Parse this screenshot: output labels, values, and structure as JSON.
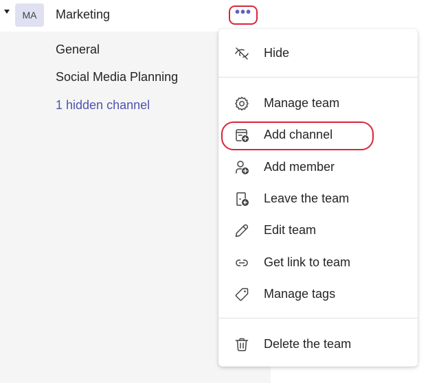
{
  "team": {
    "avatar_initials": "MA",
    "name": "Marketing",
    "more_label": "•••"
  },
  "channels": [
    {
      "label": "General"
    },
    {
      "label": "Social Media Planning"
    },
    {
      "label": "1 hidden channel"
    }
  ],
  "menu": {
    "hide": "Hide",
    "manage_team": "Manage team",
    "add_channel": "Add channel",
    "add_member": "Add member",
    "leave_team": "Leave the team",
    "edit_team": "Edit team",
    "get_link": "Get link to team",
    "manage_tags": "Manage tags",
    "delete_team": "Delete the team"
  },
  "icons": {
    "hide": "eye-off-icon",
    "manage_team": "gear-icon",
    "add_channel": "add-channel-icon",
    "add_member": "add-person-icon",
    "leave_team": "leave-door-icon",
    "edit_team": "pencil-icon",
    "get_link": "link-icon",
    "manage_tags": "tag-icon",
    "delete_team": "trash-icon"
  },
  "colors": {
    "accent": "#5b5fc7",
    "link": "#4f52b2",
    "annotation_red": "#d9243a"
  }
}
